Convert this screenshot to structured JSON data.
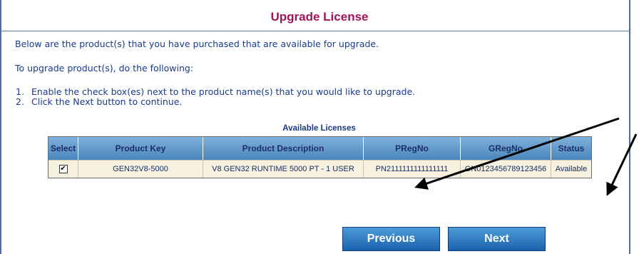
{
  "page": {
    "title": "Upgrade License",
    "intro": "Below are the product(s) that you have purchased that are available for upgrade.",
    "instructions_heading": "To upgrade product(s), do the following:",
    "steps": [
      {
        "num": "1.",
        "text": "Enable the check box(es) next to the product name(s) that you would like to upgrade."
      },
      {
        "num": "2.",
        "text": "Click the Next button to continue."
      }
    ]
  },
  "table": {
    "caption": "Available Licenses",
    "headers": [
      "Select",
      "Product Key",
      "Product Description",
      "PRegNo",
      "GRegNo",
      "Status"
    ],
    "rows": [
      {
        "checked": true,
        "product_key": "GEN32V8-5000",
        "description": "V8 GEN32 RUNTIME 5000 PT - 1 USER",
        "pregno": "PN2111111111111111",
        "gregno": "GN0123456789123456",
        "status": "Available"
      }
    ]
  },
  "buttons": {
    "previous": "Previous",
    "next": "Next"
  },
  "colors": {
    "title": "#a0155a",
    "text": "#1a3a8a",
    "header_bg": "#5b95c9",
    "row_bg": "#f6f1de",
    "button_bg": "#2a78c2"
  }
}
